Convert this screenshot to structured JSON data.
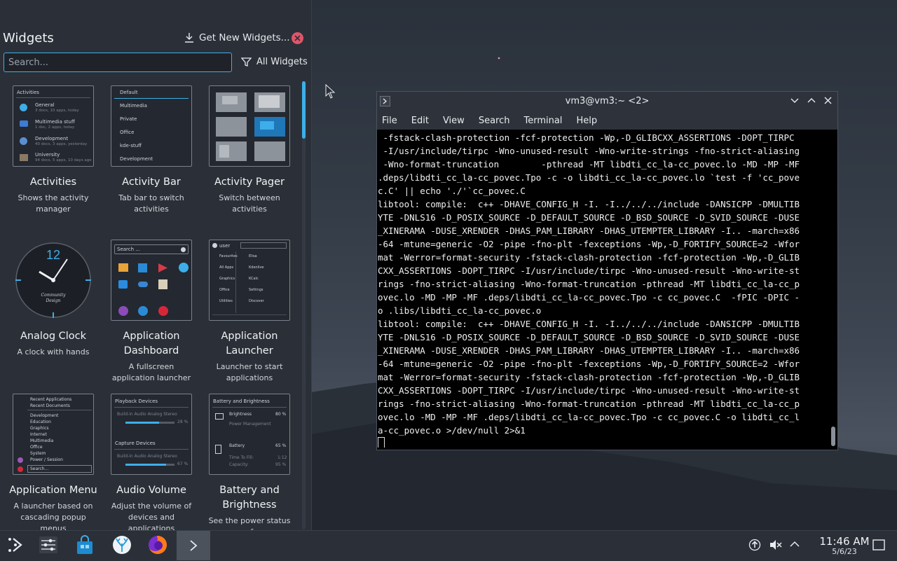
{
  "panel": {
    "title": "Widgets",
    "get_new_label": "Get New Widgets...",
    "search_placeholder": "Search...",
    "filter_label": "All Widgets"
  },
  "widgets": [
    {
      "name": "Activities",
      "desc": "Shows the activity manager"
    },
    {
      "name": "Activity Bar",
      "desc": "Tab bar to switch activities"
    },
    {
      "name": "Activity Pager",
      "desc": "Switch between activities"
    },
    {
      "name": "Analog Clock",
      "desc": "A clock with hands"
    },
    {
      "name": "Application Dashboard",
      "desc": "A fullscreen application launcher"
    },
    {
      "name": "Application Launcher",
      "desc": "Launcher to start applications"
    },
    {
      "name": "Application Menu",
      "desc": "A launcher based on cascading popup menus"
    },
    {
      "name": "Audio Volume",
      "desc": "Adjust the volume of devices and applications"
    },
    {
      "name": "Battery and Brightness",
      "desc": "See the power status of"
    }
  ],
  "thumbs": {
    "activities": {
      "header": "Activities",
      "items": [
        {
          "title": "General",
          "sub": "3 docs, 10 apps, today"
        },
        {
          "title": "Multimedia stuff",
          "sub": "1 doc, 2 apps, today"
        },
        {
          "title": "Development",
          "sub": "40 docs, 3 apps, yesterday"
        },
        {
          "title": "University",
          "sub": "94 docs, 5 apps, 10 days ago"
        }
      ]
    },
    "activity_bar": [
      "Default",
      "Multimedia",
      "Private",
      "Office",
      "kde-stuff",
      "Development"
    ],
    "analog_clock": {
      "twelve": "12",
      "brand1": "Community",
      "brand2": "Design"
    },
    "dashboard_search": "Search ...",
    "launcher": {
      "user": "user",
      "left": [
        "Favourites",
        "All Apps",
        "Graphics",
        "Office",
        "Utilities"
      ],
      "right": [
        "Elisa",
        "Kdenlive",
        "KCalc",
        "Settings",
        "Discover"
      ]
    },
    "app_menu": {
      "top": [
        "Recent Applications",
        "Recent Documents"
      ],
      "items": [
        "Development",
        "Education",
        "Graphics",
        "Internet",
        "Multimedia",
        "Office",
        "System",
        "Power / Session"
      ],
      "search": "Search..."
    },
    "audio": {
      "playback": "Playback Devices",
      "p_dev": "Build-in Audio Analog Stereo",
      "p_pct": "28 %",
      "capture": "Capture Devices",
      "c_dev": "Build-in Audio Analog Stereo",
      "c_pct": "67 %"
    },
    "battery": {
      "header": "Battery and Brightness",
      "brightness": "Brightness",
      "b_pct": "80 %",
      "power_mgmt": "Power Management",
      "battery": "Battery",
      "bat_pct": "65 %",
      "ttf_label": "Time To Fill:",
      "ttf": "1:12",
      "cap_label": "Capacity:",
      "cap": "95 %"
    }
  },
  "terminal": {
    "title": "vm3@vm3:~ <2>",
    "menu": [
      "File",
      "Edit",
      "View",
      "Search",
      "Terminal",
      "Help"
    ],
    "lines": [
      " -fstack-clash-protection -fcf-protection -Wp,-D_GLIBCXX_ASSERTIONS -DOPT_TIRPC",
      " -I/usr/include/tirpc -Wno-unused-result -Wno-write-strings -fno-strict-aliasing",
      " -Wno-format-truncation        -pthread -MT libdti_cc_la-cc_povec.lo -MD -MP -MF",
      ".deps/libdti_cc_la-cc_povec.Tpo -c -o libdti_cc_la-cc_povec.lo `test -f 'cc_pove",
      "c.C' || echo './'`cc_povec.C",
      "libtool: compile:  c++ -DHAVE_CONFIG_H -I. -I../../../include -DANSICPP -DMULTIB",
      "YTE -DNLS16 -D_POSIX_SOURCE -D_DEFAULT_SOURCE -D_BSD_SOURCE -D_SVID_SOURCE -DUSE",
      "_XINERAMA -DUSE_XRENDER -DHAS_PAM_LIBRARY -DHAS_UTEMPTER_LIBRARY -I.. -march=x86",
      "-64 -mtune=generic -O2 -pipe -fno-plt -fexceptions -Wp,-D_FORTIFY_SOURCE=2 -Wfor",
      "mat -Werror=format-security -fstack-clash-protection -fcf-protection -Wp,-D_GLIB",
      "CXX_ASSERTIONS -DOPT_TIRPC -I/usr/include/tirpc -Wno-unused-result -Wno-write-st",
      "rings -fno-strict-aliasing -Wno-format-truncation -pthread -MT libdti_cc_la-cc_p",
      "ovec.lo -MD -MP -MF .deps/libdti_cc_la-cc_povec.Tpo -c cc_povec.C  -fPIC -DPIC -",
      "o .libs/libdti_cc_la-cc_povec.o",
      "libtool: compile:  c++ -DHAVE_CONFIG_H -I. -I../../../include -DANSICPP -DMULTIB",
      "YTE -DNLS16 -D_POSIX_SOURCE -D_DEFAULT_SOURCE -D_BSD_SOURCE -D_SVID_SOURCE -DUSE",
      "_XINERAMA -DUSE_XRENDER -DHAS_PAM_LIBRARY -DHAS_UTEMPTER_LIBRARY -I.. -march=x86",
      "-64 -mtune=generic -O2 -pipe -fno-plt -fexceptions -Wp,-D_FORTIFY_SOURCE=2 -Wfor",
      "mat -Werror=format-security -fstack-clash-protection -fcf-protection -Wp,-D_GLIB",
      "CXX_ASSERTIONS -DOPT_TIRPC -I/usr/include/tirpc -Wno-unused-result -Wno-write-st",
      "rings -fno-strict-aliasing -Wno-format-truncation -pthread -MT libdti_cc_la-cc_p",
      "ovec.lo -MD -MP -MF .deps/libdti_cc_la-cc_povec.Tpo -c cc_povec.C -o libdti_cc_l",
      "a-cc_povec.o >/dev/null 2>&1"
    ]
  },
  "taskbar": {
    "time": "11:46 AM",
    "date": "5/6/23"
  },
  "colors": {
    "accent": "#3daee9",
    "panel_bg": "#2b3038",
    "close_red": "#e0556a"
  }
}
